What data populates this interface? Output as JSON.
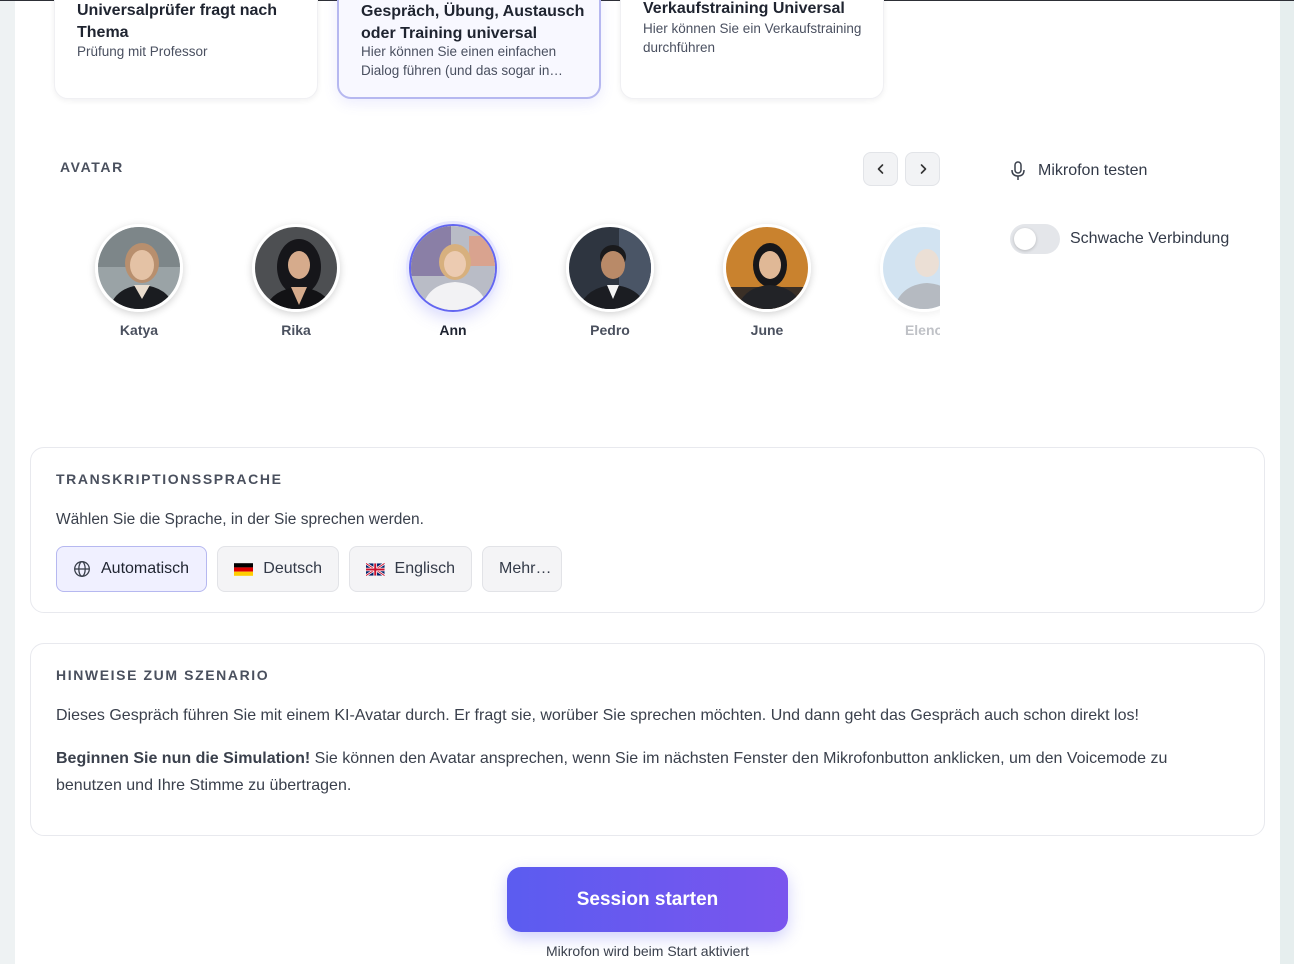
{
  "scenarios": [
    {
      "title": "Universalprüfer fragt nach Thema",
      "desc": "Prüfung mit Professor"
    },
    {
      "title": "Gespräch, Übung, Austausch oder Training universal",
      "desc": "Hier können Sie einen einfachen Dialog führen (und das sogar in mehreren Sprachen)"
    },
    {
      "title": "Verkaufstraining Universal",
      "desc": "Hier können Sie ein Verkaufstraining durchführen"
    }
  ],
  "avatar_section": {
    "label": "AVATAR",
    "avatars": [
      "Katya",
      "Rika",
      "Ann",
      "Pedro",
      "June",
      "Eleno"
    ],
    "selected": "Ann"
  },
  "side_options": {
    "mic_test": "Mikrofon testen",
    "weak_connection": "Schwache Verbindung",
    "weak_connection_enabled": false
  },
  "transcription": {
    "label": "TRANSKRIPTIONSSPRACHE",
    "subtitle": "Wählen Sie die Sprache, in der Sie sprechen werden.",
    "options": [
      "Automatisch",
      "Deutsch",
      "Englisch",
      "Mehr…"
    ],
    "selected": "Automatisch"
  },
  "hints": {
    "label": "HINWEISE ZUM SZENARIO",
    "paragraph1": "Dieses Gespräch führen Sie mit einem KI-Avatar durch. Er fragt sie, worüber Sie sprechen möchten. Und dann geht das Gespräch auch schon direkt los!",
    "paragraph2_bold": "Beginnen Sie nun die Simulation!",
    "paragraph2_rest": " Sie können den Avatar ansprechen, wenn Sie im nächsten Fenster den Mikrofonbutton anklicken, um den Voicemode zu benutzen und Ihre Stimme zu übertragen."
  },
  "start": {
    "button": "Session starten",
    "note": "Mikrofon wird beim Start aktiviert"
  },
  "colors": {
    "accent": "#6366f1",
    "accent_end": "#7a55ee"
  }
}
